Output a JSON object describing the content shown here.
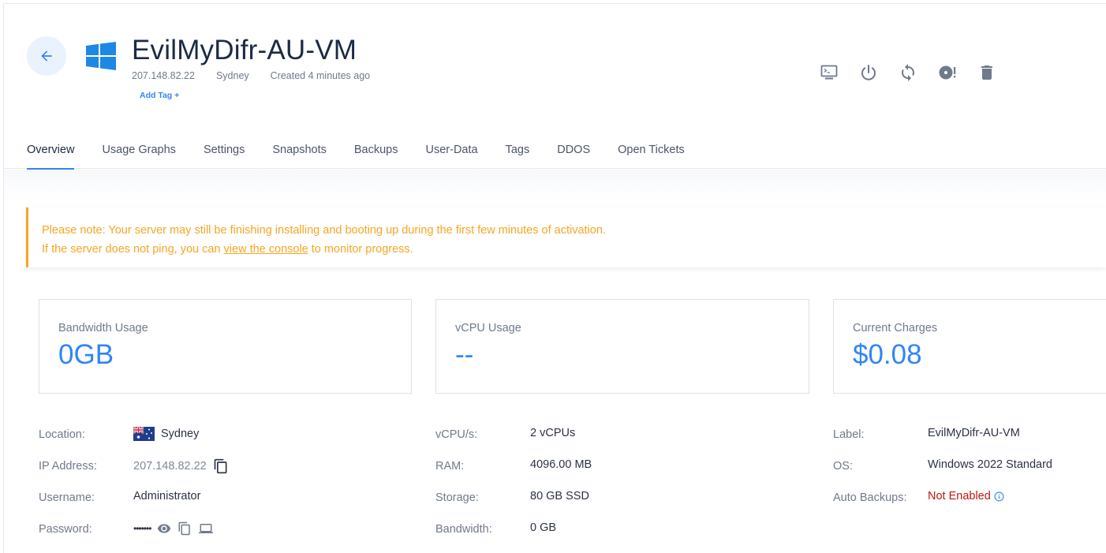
{
  "header": {
    "title": "EvilMyDifr-AU-VM",
    "ip": "207.148.82.22",
    "location": "Sydney",
    "created": "Created 4 minutes ago",
    "add_tag": "Add Tag +",
    "os_icon": "windows-logo"
  },
  "actions": [
    {
      "name": "console-icon"
    },
    {
      "name": "power-icon"
    },
    {
      "name": "restart-icon"
    },
    {
      "name": "reinstall-icon"
    },
    {
      "name": "trash-icon"
    }
  ],
  "tabs": [
    "Overview",
    "Usage Graphs",
    "Settings",
    "Snapshots",
    "Backups",
    "User-Data",
    "Tags",
    "DDOS",
    "Open Tickets"
  ],
  "notice": {
    "line1": "Please note: Your server may still be finishing installing and booting up during the first few minutes of activation.",
    "line2_before": "If the server does not ping, you can ",
    "line2_link": "view the console",
    "line2_after": " to monitor progress."
  },
  "cards": [
    {
      "label": "Bandwidth Usage",
      "value": "0GB"
    },
    {
      "label": "vCPU Usage",
      "value": "--"
    },
    {
      "label": "Current Charges",
      "value": "$0.08"
    }
  ],
  "details": {
    "left": {
      "location_label": "Location:",
      "location_value": "Sydney",
      "ip_label": "IP Address:",
      "ip_value": "207.148.82.22",
      "user_label": "Username:",
      "user_value": "Administrator",
      "pass_label": "Password:",
      "pass_value": "•••••••"
    },
    "middle": {
      "vcpu_label": "vCPU/s:",
      "vcpu_value": "2 vCPUs",
      "ram_label": "RAM:",
      "ram_value": "4096.00 MB",
      "storage_label": "Storage:",
      "storage_value": "80 GB SSD",
      "bw_label": "Bandwidth:",
      "bw_value": "0 GB"
    },
    "right": {
      "label_label": "Label:",
      "label_value": "EvilMyDifr-AU-VM",
      "os_label": "OS:",
      "os_value": "Windows 2022 Standard",
      "backups_label": "Auto Backups:",
      "backups_value": "Not Enabled"
    }
  },
  "colors": {
    "accent": "#2f86f6",
    "warning": "#f5a623",
    "danger": "#c0180d"
  }
}
